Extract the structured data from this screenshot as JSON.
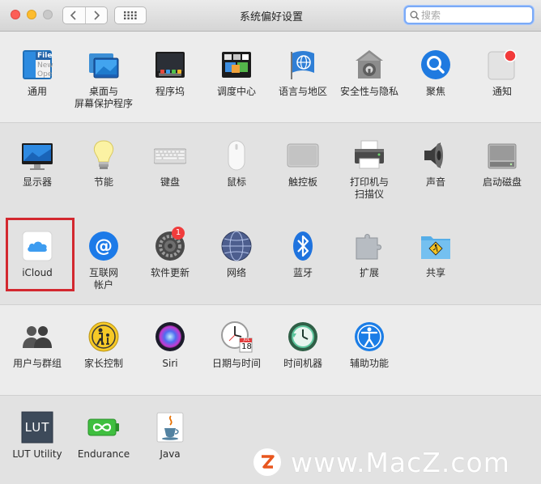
{
  "window": {
    "title": "系统偏好设置",
    "search_placeholder": "搜索"
  },
  "rows": [
    [
      {
        "label": "通用",
        "icon": "general-icon"
      },
      {
        "label": "桌面与\n屏幕保护程序",
        "icon": "desktop-screensaver-icon"
      },
      {
        "label": "程序坞",
        "icon": "dock-icon"
      },
      {
        "label": "调度中心",
        "icon": "mission-control-icon"
      },
      {
        "label": "语言与地区",
        "icon": "language-region-icon"
      },
      {
        "label": "安全性与隐私",
        "icon": "security-privacy-icon"
      },
      {
        "label": "聚焦",
        "icon": "spotlight-icon"
      },
      {
        "label": "通知",
        "icon": "notifications-icon"
      }
    ],
    [
      {
        "label": "显示器",
        "icon": "displays-icon"
      },
      {
        "label": "节能",
        "icon": "energy-saver-icon"
      },
      {
        "label": "键盘",
        "icon": "keyboard-icon"
      },
      {
        "label": "鼠标",
        "icon": "mouse-icon"
      },
      {
        "label": "触控板",
        "icon": "trackpad-icon"
      },
      {
        "label": "打印机与\n扫描仪",
        "icon": "printers-scanners-icon"
      },
      {
        "label": "声音",
        "icon": "sound-icon"
      },
      {
        "label": "启动磁盘",
        "icon": "startup-disk-icon"
      }
    ],
    [
      {
        "label": "iCloud",
        "icon": "icloud-icon"
      },
      {
        "label": "互联网\n帐户",
        "icon": "internet-accounts-icon"
      },
      {
        "label": "软件更新",
        "icon": "software-update-icon",
        "badge": "1"
      },
      {
        "label": "网络",
        "icon": "network-icon"
      },
      {
        "label": "蓝牙",
        "icon": "bluetooth-icon"
      },
      {
        "label": "扩展",
        "icon": "extensions-icon"
      },
      {
        "label": "共享",
        "icon": "sharing-icon"
      }
    ],
    [
      {
        "label": "用户与群组",
        "icon": "users-groups-icon"
      },
      {
        "label": "家长控制",
        "icon": "parental-controls-icon"
      },
      {
        "label": "Siri",
        "icon": "siri-icon"
      },
      {
        "label": "日期与时间",
        "icon": "date-time-icon"
      },
      {
        "label": "时间机器",
        "icon": "time-machine-icon"
      },
      {
        "label": "辅助功能",
        "icon": "accessibility-icon"
      }
    ],
    [
      {
        "label": "LUT Utility",
        "icon": "lut-utility-icon"
      },
      {
        "label": "Endurance",
        "icon": "endurance-icon"
      },
      {
        "label": "Java",
        "icon": "java-icon"
      }
    ]
  ],
  "icon_text": {
    "general": [
      "File",
      "New",
      "Ope"
    ],
    "calendar": [
      "JUL",
      "18"
    ],
    "lut": "LUT"
  },
  "watermark": "www.MacZ.com",
  "colors": {
    "highlight": "#d3282f",
    "search_focus": "#7baaf7"
  }
}
